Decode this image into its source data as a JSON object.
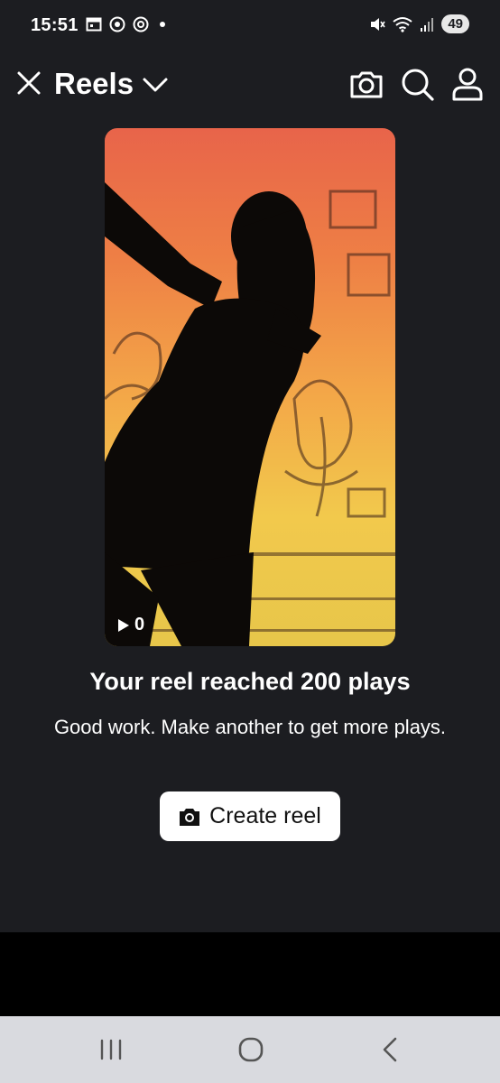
{
  "status_bar": {
    "time": "15:51",
    "battery": "49",
    "icons_left": [
      "calendar-icon",
      "chrome-icon",
      "threads-icon",
      "dot-icon"
    ],
    "icons_right": [
      "mute-icon",
      "wifi-icon",
      "signal-icon",
      "battery-icon"
    ]
  },
  "header": {
    "title": "Reels",
    "icons": [
      "close-icon",
      "chevron-down-icon",
      "camera-icon",
      "search-icon",
      "profile-icon"
    ]
  },
  "reel": {
    "play_count": "0"
  },
  "main": {
    "headline": "Your reel reached 200 plays",
    "subtext": "Good work. Make another to get more plays.",
    "create_button_label": "Create reel"
  },
  "nav_bar": {
    "icons": [
      "recents-icon",
      "home-icon",
      "back-icon"
    ]
  },
  "colors": {
    "background": "#1c1d21",
    "reel_gradient_top": "#e8644a",
    "reel_gradient_bottom": "#e7c64a",
    "button_bg": "#ffffff",
    "nav_bar_bg": "#d9dadf"
  }
}
